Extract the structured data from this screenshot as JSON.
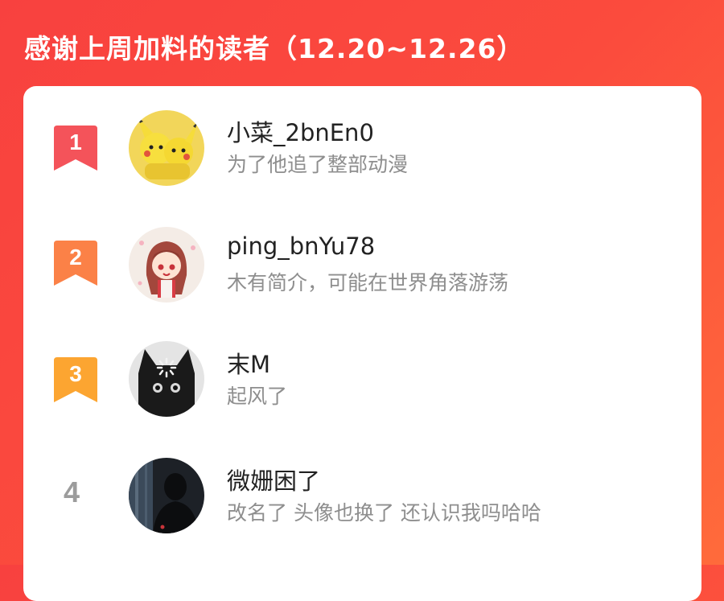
{
  "header": {
    "title": "感谢上周加料的读者（12.20~12.26）"
  },
  "colors": {
    "background_red": "#f8413f",
    "rank1": "#f4535a",
    "rank2": "#fb8147",
    "rank3": "#fca531",
    "rank_plain": "#9c9c9c"
  },
  "readers": [
    {
      "rank": "1",
      "name": "小菜_2bnEn0",
      "bio": "为了他追了整部动漫",
      "avatar": "pikachu-avatar"
    },
    {
      "rank": "2",
      "name": "ping_bnYu78",
      "bio": "木有简介，可能在世界角落游荡",
      "avatar": "anime-girl-avatar"
    },
    {
      "rank": "3",
      "name": "末M",
      "bio": "起风了",
      "avatar": "black-cat-avatar"
    },
    {
      "rank": "4",
      "name": "微姗困了",
      "bio": "改名了 头像也换了 还认识我吗哈哈",
      "avatar": "silhouette-avatar"
    }
  ]
}
